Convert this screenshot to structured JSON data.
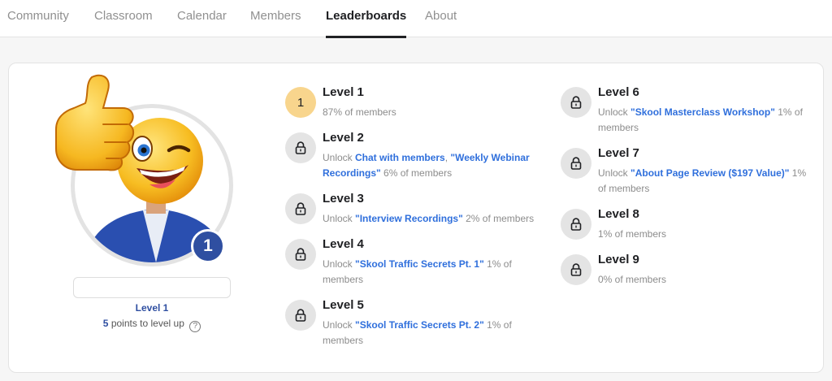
{
  "nav": {
    "tabs": [
      {
        "label": "Community"
      },
      {
        "label": "Classroom"
      },
      {
        "label": "Calendar"
      },
      {
        "label": "Members"
      },
      {
        "label": "Leaderboards"
      },
      {
        "label": "About"
      }
    ],
    "active": "Leaderboards"
  },
  "profile": {
    "badge_number": "1",
    "level_label": "Level 1",
    "points": "5",
    "points_suffix": "points to level up",
    "help_symbol": "?"
  },
  "levels": [
    {
      "number": "1",
      "title": "Level 1",
      "members": "87% of members"
    },
    {
      "title": "Level 2",
      "unlock_prefix": "Unlock ",
      "links": [
        "Chat with members",
        "\"Weekly Webinar Recordings\""
      ],
      "separator": ", ",
      "members": " 6% of members"
    },
    {
      "title": "Level 3",
      "unlock_prefix": "Unlock ",
      "links": [
        "\"Interview Recordings\""
      ],
      "members": " 2% of members"
    },
    {
      "title": "Level 4",
      "unlock_prefix": "Unlock ",
      "links": [
        "\"Skool Traffic Secrets Pt. 1\""
      ],
      "members": " 1% of members"
    },
    {
      "title": "Level 5",
      "unlock_prefix": "Unlock ",
      "links": [
        "\"Skool Traffic Secrets Pt. 2\""
      ],
      "members": " 1% of members"
    },
    {
      "title": "Level 6",
      "unlock_prefix": "Unlock ",
      "links": [
        "\"Skool Masterclass Workshop\""
      ],
      "members": " 1% of members"
    },
    {
      "title": "Level 7",
      "unlock_prefix": "Unlock ",
      "links": [
        "\"About Page Review ($197 Value)\""
      ],
      "members": " 1% of members"
    },
    {
      "title": "Level 8",
      "members": "1% of members"
    },
    {
      "title": "Level 9",
      "members": "0% of members"
    }
  ],
  "colors": {
    "accent_blue": "#2f4fa1",
    "link_blue": "#2f6fdc",
    "current_level_bg": "#f8d58d",
    "locked_level_bg": "#e4e4e4"
  },
  "icons": {
    "locked": "lock-icon",
    "help": "help-icon"
  }
}
